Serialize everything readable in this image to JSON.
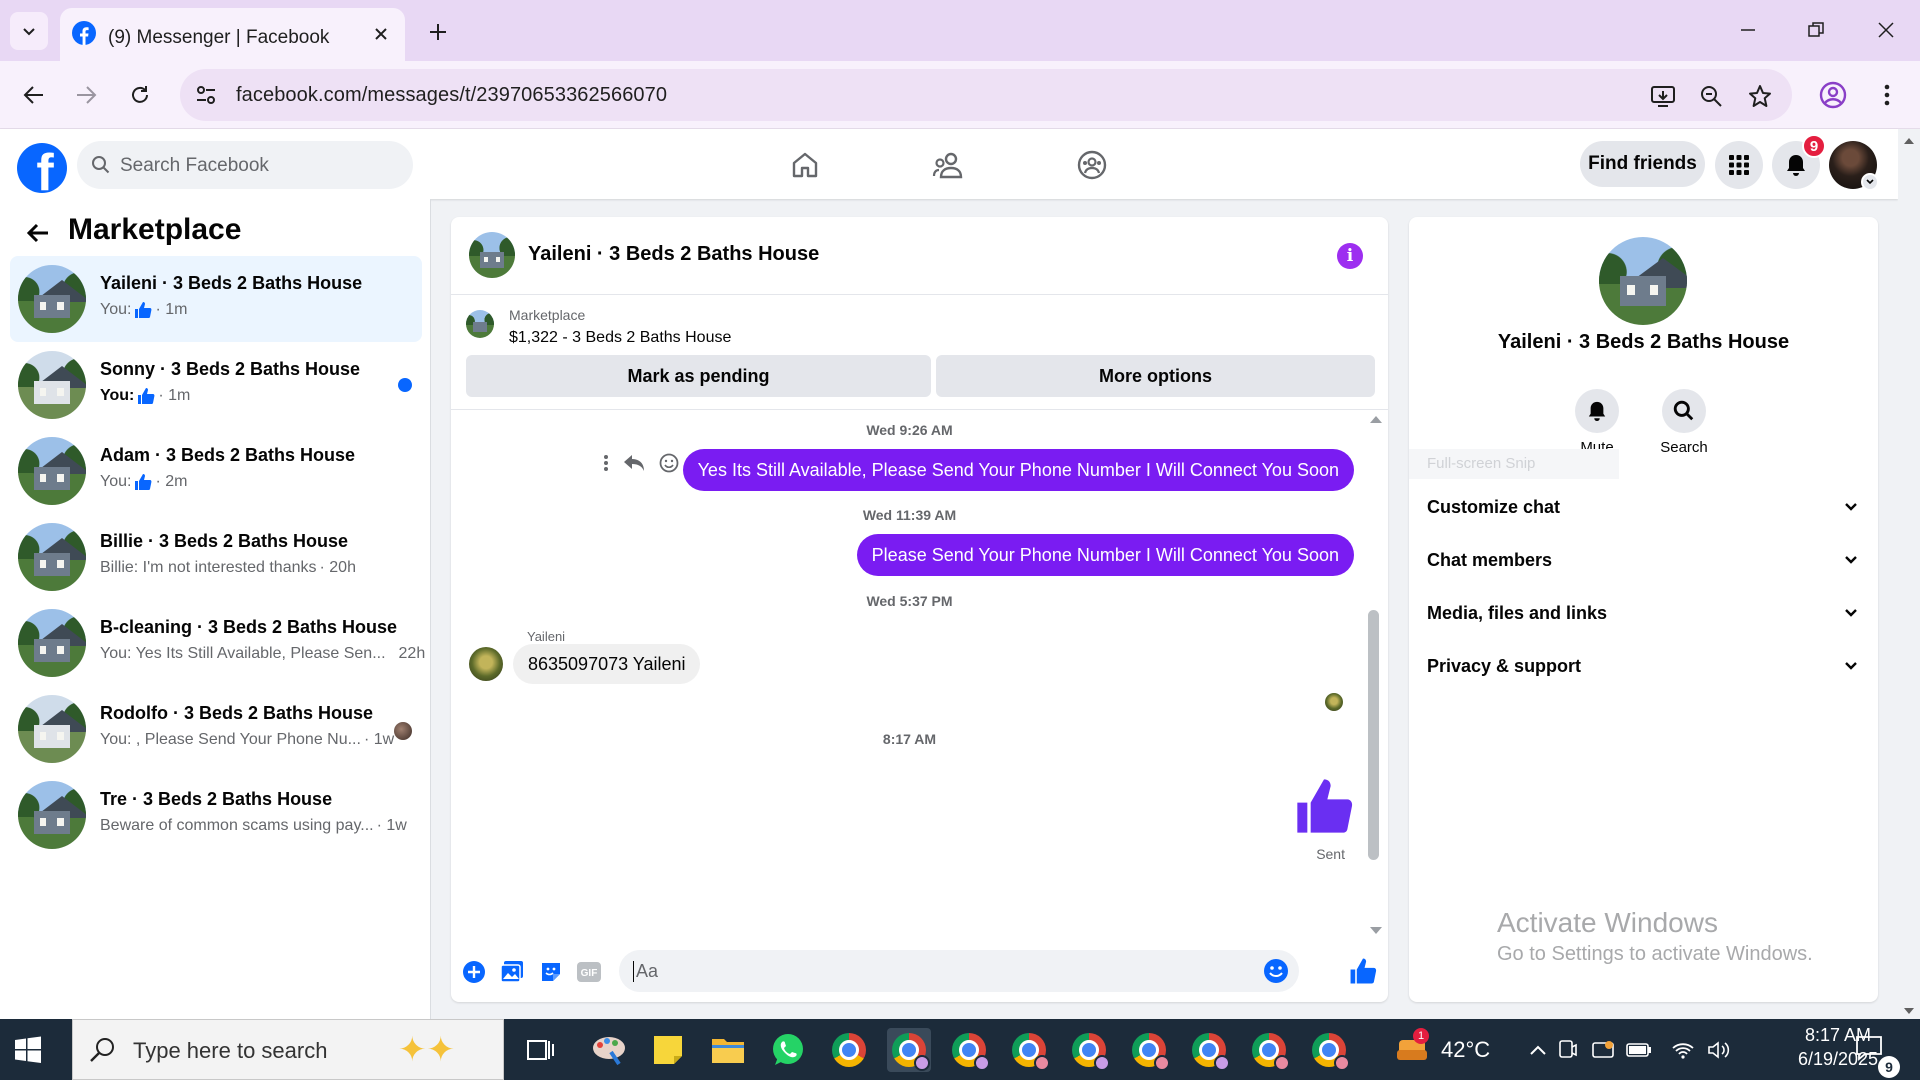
{
  "browser": {
    "tab_title": "(9) Messenger | Facebook",
    "url": "facebook.com/messages/t/23970653362566070"
  },
  "fb_header": {
    "search_placeholder": "Search Facebook",
    "find_friends_label": "Find friends",
    "notification_count": "9"
  },
  "sidebar": {
    "title": "Marketplace",
    "conversations": [
      {
        "name": "Yaileni · 3 Beds 2 Baths House",
        "prefix": "You:",
        "preview": "",
        "time": "· 1m",
        "like": true,
        "active": true
      },
      {
        "name": "Sonny · 3 Beds 2 Baths House",
        "prefix": "You:",
        "preview": "",
        "time": "· 1m",
        "like": true,
        "unread": true
      },
      {
        "name": "Adam · 3 Beds 2 Baths House",
        "prefix": "You:",
        "preview": "",
        "time": "· 2m",
        "like": true
      },
      {
        "name": "Billie · 3 Beds 2 Baths House",
        "prefix": "",
        "preview": "Billie: I'm not interested thanks",
        "time": "· 20h"
      },
      {
        "name": "B-cleaning · 3 Beds 2 Baths House",
        "prefix": "",
        "preview": "You: Yes Its Still Available, Please Sen...",
        "time": "22h"
      },
      {
        "name": "Rodolfo · 3 Beds 2 Baths House",
        "prefix": "",
        "preview": "You: , Please Send Your Phone Nu...",
        "time": "· 1w"
      },
      {
        "name": "Tre · 3 Beds 2 Baths House",
        "prefix": "",
        "preview": "Beware of common scams using pay...",
        "time": "· 1w"
      }
    ]
  },
  "chat": {
    "title": "Yaileni · 3 Beds 2 Baths House",
    "listing_label": "Marketplace",
    "listing_price": "$1,322 - 3 Beds 2 Baths House",
    "mark_pending_label": "Mark as pending",
    "more_options_label": "More options",
    "messages": [
      {
        "timestamp": "Wed 9:26 AM",
        "text": "Yes Its Still Available, Please Send Your Phone Number I Will Connect You Soon"
      },
      {
        "timestamp": "Wed 11:39 AM",
        "text": "Please Send Your Phone Number I Will Connect You Soon"
      },
      {
        "timestamp": "Wed 5:37 PM",
        "sender": "Yaileni",
        "text": "8635097073 Yaileni"
      },
      {
        "timestamp": "8:17 AM",
        "status": "Sent"
      }
    ],
    "composer_placeholder": "Aa"
  },
  "right_panel": {
    "name": "Yaileni · 3 Beds 2 Baths House",
    "mute_label": "Mute",
    "search_label": "Search",
    "snip_ghost": "Full-screen Snip",
    "sections": [
      "Customize chat",
      "Chat members",
      "Media, files and links",
      "Privacy & support"
    ],
    "activate_title": "Activate Windows",
    "activate_sub": "Go to Settings to activate Windows."
  },
  "taskbar": {
    "search_placeholder": "Type here to search",
    "weather": "42°C",
    "weather_badge": "1",
    "time": "8:17 AM",
    "date": "6/19/2025",
    "notif_count": "9"
  },
  "colors": {
    "fb_blue": "#0866ff",
    "bubble_purple": "#7a1cf2",
    "like_blue": "#0866ff"
  }
}
